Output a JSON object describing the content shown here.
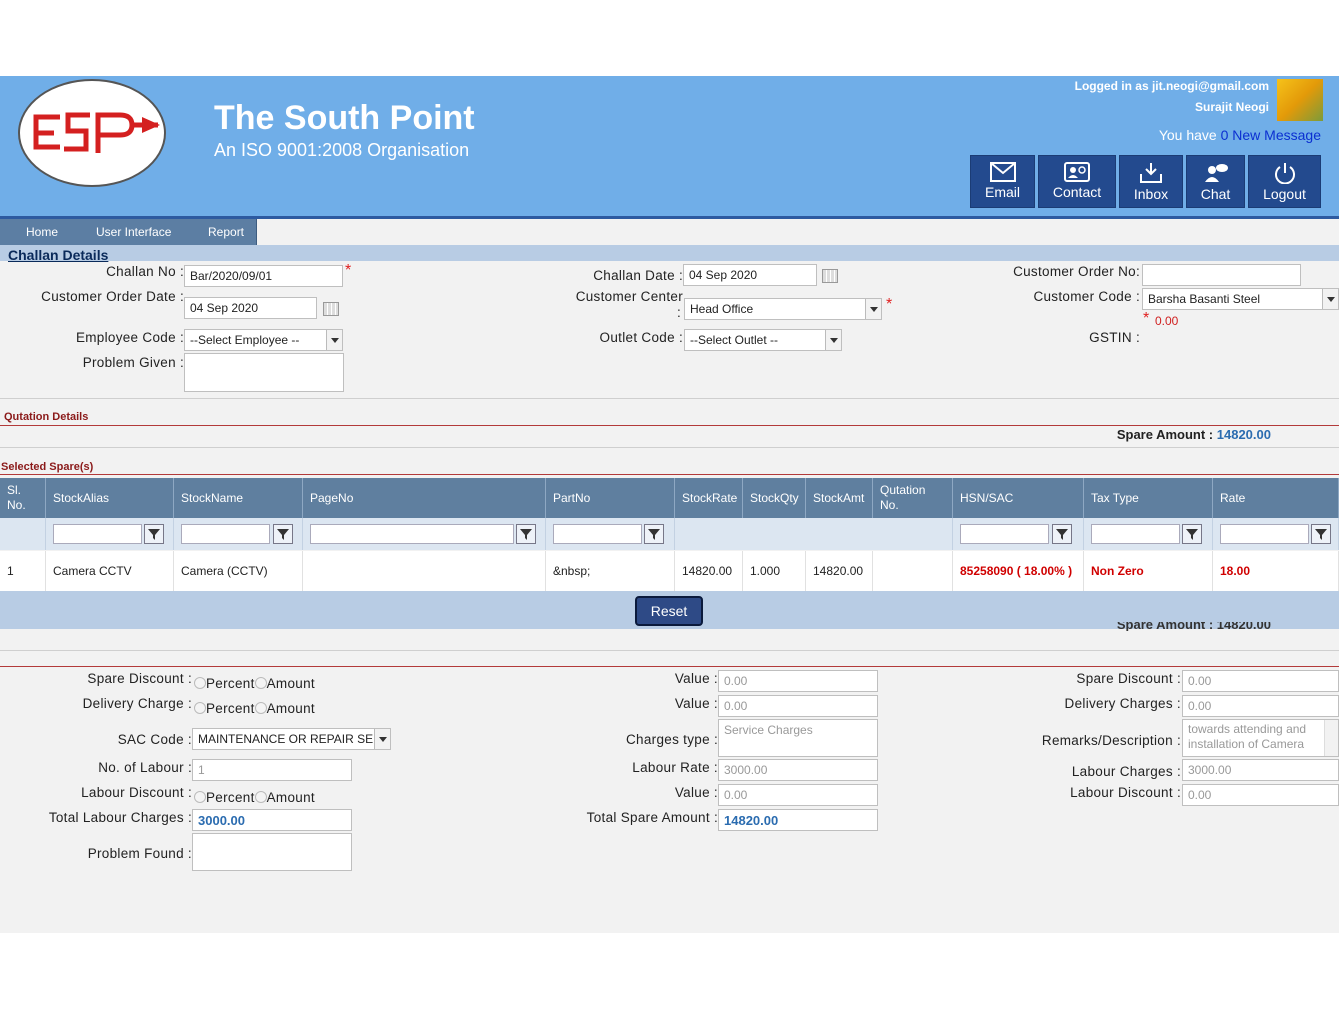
{
  "header": {
    "company": "The South Point",
    "tagline": "An ISO 9001:2008 Organisation",
    "logged_in": "Logged in as jit.neogi@gmail.com",
    "user_name": "Surajit Neogi",
    "message_prefix": "You have",
    "message_link": "0 New Message",
    "buttons": {
      "email": "Email",
      "contact": "Contact",
      "inbox": "Inbox",
      "chat": "Chat",
      "logout": "Logout"
    }
  },
  "menu": {
    "home": "Home",
    "ui": "User Interface",
    "report": "Report"
  },
  "challan": {
    "title": "Challan Details",
    "challan_no_label": "Challan No :",
    "challan_no": "Bar/2020/09/01",
    "customer_order_date_label": "Customer Order Date :",
    "customer_order_date": "04 Sep 2020",
    "employee_code_label": "Employee Code :",
    "employee_code": "--Select Employee --",
    "problem_given_label": "Problem Given :",
    "challan_date_label": "Challan Date :",
    "challan_date": "04 Sep 2020",
    "customer_center_label": "Customer Center",
    "customer_center_colon": ":",
    "customer_center": "Head Office",
    "outlet_code_label": "Outlet Code :",
    "outlet_code": "--Select Outlet --",
    "customer_order_no_label": "Customer Order No:",
    "customer_code_label": "Customer Code :",
    "customer_code": "Barsha Basanti Steel",
    "customer_balance": "0.00",
    "gstin_label": "GSTIN :"
  },
  "quotation": {
    "title": "Qutation Details",
    "spare_amount_label": "Spare Amount :",
    "spare_amount": "14820.00",
    "spare_amount_faded": "Spare Amount : 14820.00"
  },
  "spares": {
    "title": "Selected Spare(s)",
    "columns": [
      "Sl. No.",
      "StockAlias",
      "StockName",
      "PageNo",
      "PartNo",
      "StockRate",
      "StockQty",
      "StockAmt",
      "Qutation No.",
      "HSN/SAC",
      "Tax Type",
      "Rate"
    ],
    "rows": [
      [
        "1",
        "Camera CCTV",
        "Camera (CCTV)",
        "",
        "&nbsp;",
        "14820.00",
        "1.000",
        "14820.00",
        "",
        "85258090 ( 18.00% )",
        "Non Zero",
        "18.00"
      ]
    ],
    "reset": "Reset"
  },
  "charges": {
    "spare_discount_label": "Spare Discount :",
    "delivery_charge_label": "Delivery Charge :",
    "sac_code_label": "SAC Code :",
    "sac_code": "MAINTENANCE OR REPAIR SERV",
    "labour_count_label": "No. of Labour :",
    "labour_count": "1",
    "labour_discount_label": "Labour Discount :",
    "total_labour_label": "Total Labour Charges :",
    "total_labour": "3000.00",
    "problem_found_label": "Problem Found :",
    "percent": "Percent",
    "amount": "Amount",
    "value_label": "Value :",
    "value_spare": "0.00",
    "value_delivery": "0.00",
    "charges_type_label": "Charges type :",
    "charges_type": "Service Charges",
    "labour_rate_label": "Labour Rate :",
    "labour_rate": "3000.00",
    "value_labour": "0.00",
    "total_spare_label": "Total Spare Amount :",
    "total_spare": "14820.00",
    "r_spare_discount_label": "Spare Discount :",
    "r_spare_discount": "0.00",
    "r_delivery_label": "Delivery Charges :",
    "r_delivery": "0.00",
    "remarks_label": "Remarks/Description :",
    "remarks": "towards attending and installation of Camera",
    "r_labour_charges_label": "Labour Charges :",
    "r_labour_charges": "3000.00",
    "r_labour_discount_label": "Labour Discount :",
    "r_labour_discount": "0.00"
  }
}
